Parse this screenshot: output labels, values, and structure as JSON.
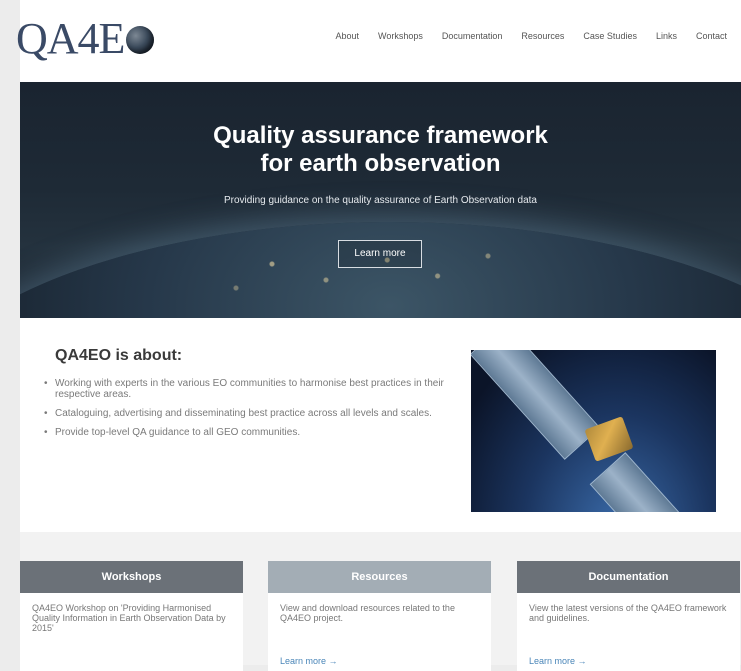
{
  "header": {
    "logo_text": "QA4E",
    "nav": [
      "About",
      "Workshops",
      "Documentation",
      "Resources",
      "Case Studies",
      "Links",
      "Contact"
    ]
  },
  "hero": {
    "title_line1": "Quality assurance framework",
    "title_line2": "for earth observation",
    "subtitle": "Providing guidance on the quality assurance of Earth Observation data",
    "button": "Learn more"
  },
  "about": {
    "title": "QA4EO is about:",
    "items": [
      "Working with experts in the various EO communities to harmonise best practices in their respective areas.",
      "Cataloguing, advertising and disseminating best practice across all levels and scales.",
      "Provide top-level QA guidance to all GEO communities."
    ]
  },
  "cards": [
    {
      "title": "Workshops",
      "text": "QA4EO Workshop on 'Providing Harmonised Quality Information in Earth Observation Data by 2015'",
      "link": "",
      "header_color": "#6b7178"
    },
    {
      "title": "Resources",
      "text": "View and download resources related to the QA4EO project.",
      "link": "Learn more →",
      "header_color": "#a3adb5"
    },
    {
      "title": "Documentation",
      "text": "View the latest versions of the QA4EO framework and guidelines.",
      "link": "Learn more →",
      "header_color": "#6b7178"
    }
  ]
}
